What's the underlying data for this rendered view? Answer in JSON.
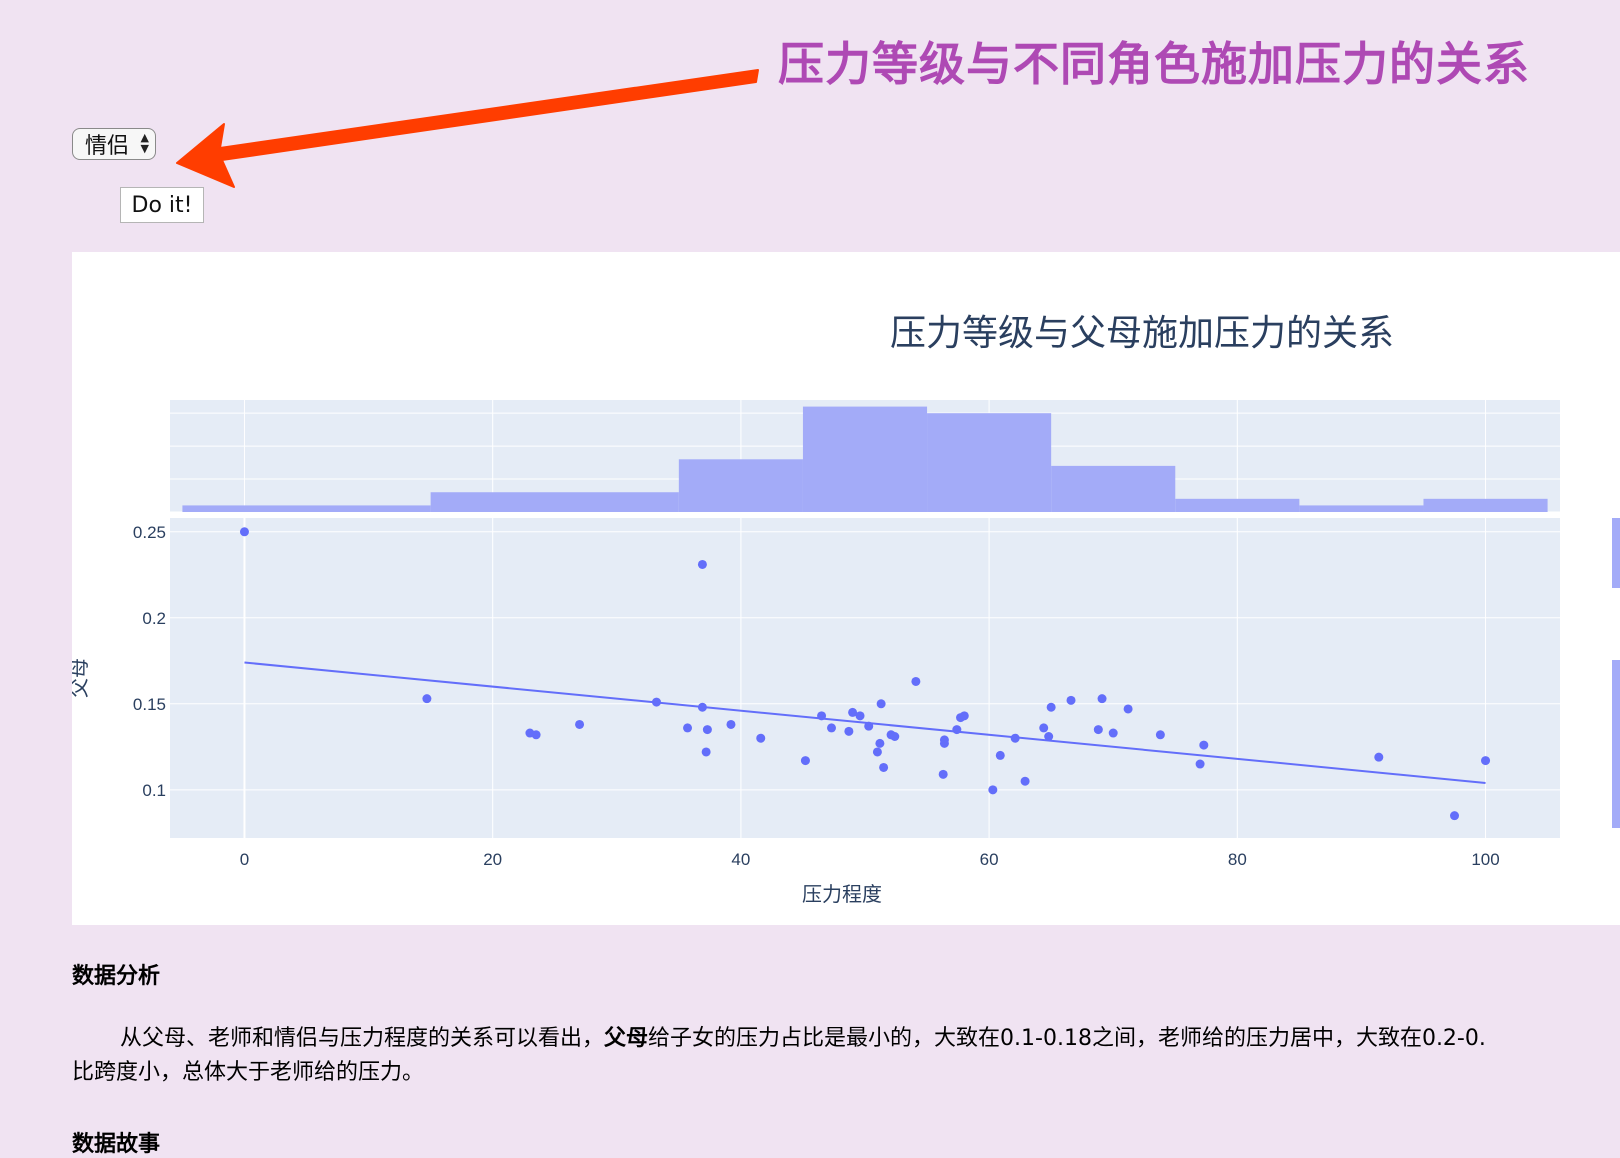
{
  "annotation": {
    "title": "压力等级与不同角色施加压力的关系",
    "arrow_color": "#ff3d00"
  },
  "controls": {
    "select_value": "情侣",
    "button_label": "Do it!"
  },
  "chart_data": {
    "type": "scatter",
    "title": "压力等级与父母施加压力的关系",
    "xlabel": "压力程度",
    "ylabel": "父母",
    "x_ticks": [
      "0",
      "20",
      "40",
      "60",
      "80",
      "100"
    ],
    "y_ticks": [
      "0.1",
      "0.15",
      "0.2",
      "0.25"
    ],
    "xlim": [
      -6,
      106
    ],
    "ylim": [
      0.072,
      0.258
    ],
    "color": "#636efa",
    "histogram_color": "#a3abf8",
    "grid": true,
    "series": [
      {
        "points": [
          [
            0,
            0.25
          ],
          [
            14.7,
            0.153
          ],
          [
            23,
            0.133
          ],
          [
            23.5,
            0.132
          ],
          [
            27,
            0.138
          ],
          [
            33.2,
            0.151
          ],
          [
            35.7,
            0.136
          ],
          [
            36.9,
            0.148
          ],
          [
            36.9,
            0.231
          ],
          [
            37.2,
            0.122
          ],
          [
            37.3,
            0.135
          ],
          [
            39.2,
            0.138
          ],
          [
            41.6,
            0.13
          ],
          [
            45.2,
            0.117
          ],
          [
            46.5,
            0.143
          ],
          [
            47.3,
            0.136
          ],
          [
            48.7,
            0.134
          ],
          [
            49,
            0.145
          ],
          [
            49.6,
            0.143
          ],
          [
            50.3,
            0.137
          ],
          [
            51,
            0.122
          ],
          [
            51.2,
            0.127
          ],
          [
            51.3,
            0.15
          ],
          [
            51.5,
            0.113
          ],
          [
            52.1,
            0.132
          ],
          [
            52.4,
            0.131
          ],
          [
            54.1,
            0.163
          ],
          [
            56.3,
            0.109
          ],
          [
            56.4,
            0.129
          ],
          [
            56.4,
            0.127
          ],
          [
            57.4,
            0.135
          ],
          [
            57.7,
            0.142
          ],
          [
            58,
            0.143
          ],
          [
            60.3,
            0.1
          ],
          [
            60.9,
            0.12
          ],
          [
            62.1,
            0.13
          ],
          [
            62.9,
            0.105
          ],
          [
            64.4,
            0.136
          ],
          [
            64.8,
            0.131
          ],
          [
            65,
            0.148
          ],
          [
            66.6,
            0.152
          ],
          [
            68.8,
            0.135
          ],
          [
            69.1,
            0.153
          ],
          [
            70,
            0.133
          ],
          [
            71.2,
            0.147
          ],
          [
            73.8,
            0.132
          ],
          [
            77,
            0.115
          ],
          [
            77.3,
            0.126
          ],
          [
            91.4,
            0.119
          ],
          [
            97.5,
            0.085
          ],
          [
            100,
            0.117
          ]
        ]
      }
    ],
    "trendline": {
      "x": [
        0,
        100
      ],
      "y": [
        0.174,
        0.104
      ]
    },
    "histogram": {
      "bin_edges": [
        -5,
        15,
        35,
        45,
        55,
        65,
        75,
        85,
        95,
        105
      ],
      "counts": [
        1,
        3,
        8,
        16,
        15,
        7,
        2,
        1,
        2
      ]
    }
  },
  "analysis": {
    "heading": "数据分析",
    "text_before": "从父母、老师和情侣与压力程度的关系可以看出，",
    "bold": "父母",
    "text_after": "给子女的压力占比是最小的，大致在0.1-0.18之间，老师给的压力居中，大致在0.2-0.",
    "line2": "比跨度小，总体大于老师给的压力。"
  },
  "story": {
    "heading": "数据故事"
  }
}
